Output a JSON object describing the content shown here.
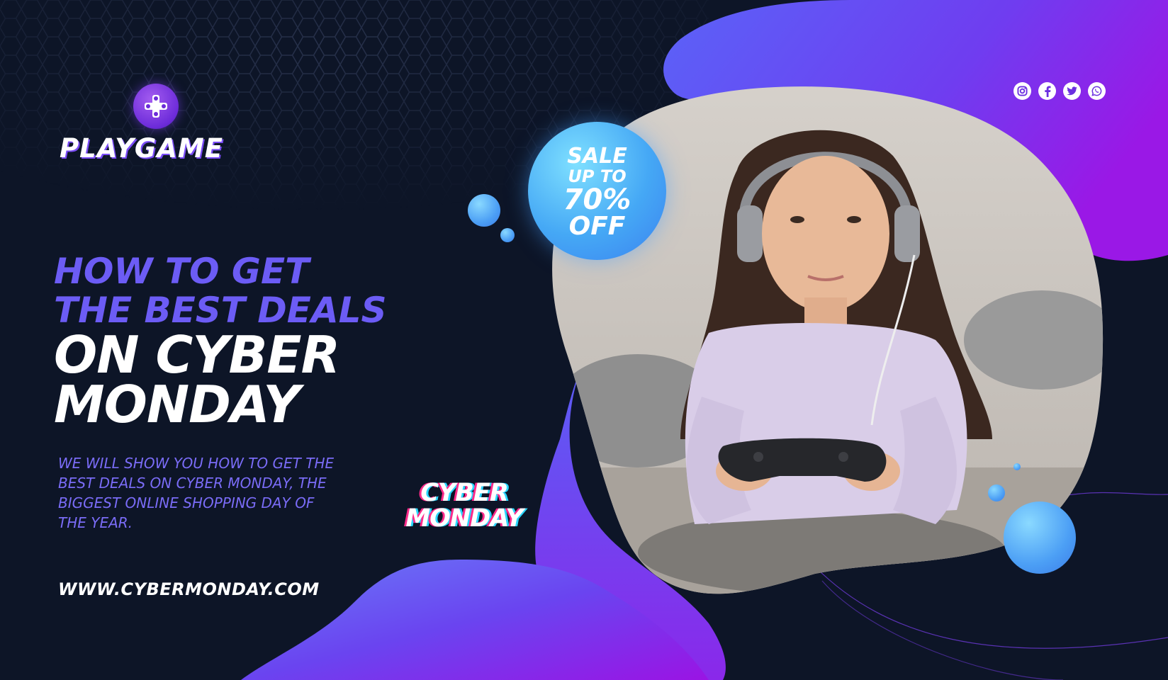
{
  "brand": {
    "name": "PLAYGAME"
  },
  "headline": {
    "line1": "HOW TO GET",
    "line2": "THE BEST DEALS",
    "line3": "ON CYBER",
    "line4": "MONDAY"
  },
  "description": "WE WILL SHOW YOU HOW TO GET THE BEST DEALS ON CYBER MONDAY, THE BIGGEST ONLINE SHOPPING DAY OF THE YEAR.",
  "website": "WWW.CYBERMONDAY.COM",
  "glitch_logo": {
    "line1": "CYBER",
    "line2": "MONDAY"
  },
  "sale_badge": {
    "line1": "SALE",
    "line2": "UP TO",
    "line3": "70%",
    "line4": "OFF"
  },
  "socials": [
    {
      "icon": "instagram-icon"
    },
    {
      "icon": "facebook-icon"
    },
    {
      "icon": "twitter-icon"
    },
    {
      "icon": "whatsapp-icon"
    }
  ],
  "colors": {
    "background": "#0d1527",
    "accent_purple": "#6c5cf5",
    "blob_gradient_start": "#5b5cf5",
    "blob_gradient_end": "#9b1fe8",
    "badge_blue": "#45a8f5"
  }
}
